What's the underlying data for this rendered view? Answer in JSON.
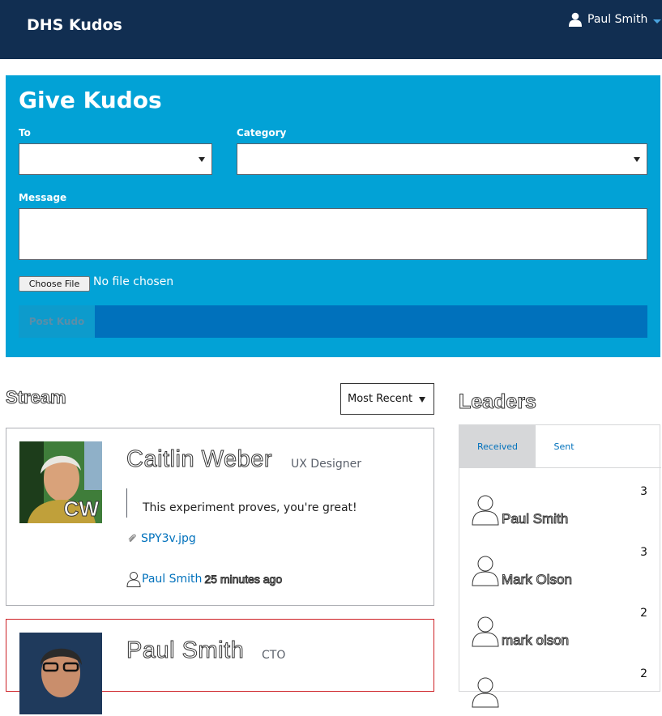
{
  "app": {
    "title": "DHS Kudos",
    "user_name": "Paul Smith"
  },
  "give_kudos": {
    "title": "Give Kudos",
    "to_label": "To",
    "category_label": "Category",
    "message_label": "Message",
    "file_button": "Choose File",
    "file_status": "No file chosen",
    "post_button": "Post Kudo"
  },
  "stream": {
    "heading": "Stream",
    "sort_value": "Most Recent",
    "cards": [
      {
        "avatar_initials": "CW",
        "name": "Caitlin Weber",
        "role": "UX Designer",
        "message": "This experiment proves, you're great!",
        "attachment": "SPY3v.jpg",
        "sender": "Paul Smith",
        "time_ago": "25 minutes ago"
      },
      {
        "name": "Paul Smith",
        "role": "CTO"
      }
    ]
  },
  "leaders": {
    "heading": "Leaders",
    "tabs": [
      "Received",
      "Sent"
    ],
    "active_tab": "Received",
    "rows": [
      {
        "name": "Paul Smith",
        "count": "3"
      },
      {
        "name": "Mark Olson",
        "count": "3"
      },
      {
        "name": "mark olson",
        "count": "2"
      },
      {
        "name": "",
        "count": "2"
      }
    ]
  },
  "colors": {
    "nav_bg": "#112e51",
    "panel_bg": "#02a2d6",
    "post_bar": "#0071bc",
    "link": "#0071bc",
    "highlight_border": "#cd2026"
  },
  "icons": [
    "person-icon",
    "caret-down-icon",
    "dropdown-arrow-icon",
    "paperclip-icon",
    "person-outline-icon"
  ]
}
